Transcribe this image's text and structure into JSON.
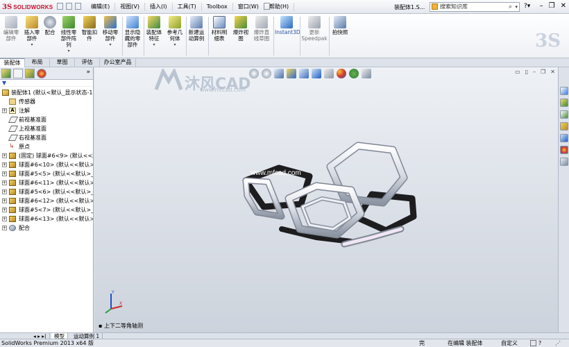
{
  "app": {
    "brand": "SOLIDWORKS",
    "menus": [
      "编辑(E)",
      "视图(V)",
      "插入(I)",
      "工具(T)",
      "Toolbox",
      "窗口(W)",
      "帮助(H)"
    ],
    "doc_title": "装配体1.S...",
    "search_placeholder": "搜索知识库"
  },
  "ribbon": {
    "buttons": [
      {
        "label": "编辑零\n部件",
        "icon": "edit-component-icon"
      },
      {
        "label": "插入零\n部件",
        "icon": "insert-component-icon"
      },
      {
        "label": "配合",
        "icon": "mate-icon"
      },
      {
        "label": "线性零\n部件阵\n列",
        "icon": "linear-pattern-icon"
      },
      {
        "label": "智能扣\n件",
        "icon": "smart-fastener-icon"
      },
      {
        "label": "移动零\n部件",
        "icon": "move-component-icon"
      },
      {
        "label": "显示隐\n藏的零\n部件",
        "icon": "show-hidden-icon"
      },
      {
        "label": "装配体\n特征",
        "icon": "assembly-feature-icon"
      },
      {
        "label": "参考几\n何体",
        "icon": "reference-geometry-icon"
      },
      {
        "label": "新建运\n动算例",
        "icon": "motion-study-icon"
      },
      {
        "label": "材料明\n细表",
        "icon": "bom-icon"
      },
      {
        "label": "爆炸视\n图",
        "icon": "exploded-view-icon"
      },
      {
        "label": "爆炸直\n线草图",
        "icon": "explode-line-icon"
      },
      {
        "label": "Instant3D",
        "icon": "instant3d-icon"
      },
      {
        "label": "更新\nSpeedpak",
        "icon": "speedpak-icon"
      },
      {
        "label": "拍快照",
        "icon": "snapshot-icon"
      }
    ]
  },
  "tabs": [
    "装配体",
    "布局",
    "草图",
    "评估",
    "办公室产品"
  ],
  "tree": {
    "root": "装配体1 (默认<默认_显示状态-1>)",
    "items": [
      {
        "label": "传感器",
        "icon": "sensor-icon",
        "expand": false
      },
      {
        "label": "注解",
        "icon": "annotation-icon",
        "expand": true
      },
      {
        "label": "前视基准面",
        "icon": "plane-icon",
        "expand": false
      },
      {
        "label": "上视基准面",
        "icon": "plane-icon",
        "expand": false
      },
      {
        "label": "右视基准面",
        "icon": "plane-icon",
        "expand": false
      },
      {
        "label": "原点",
        "icon": "origin-icon",
        "expand": false
      },
      {
        "label": "(固定) 球面#6<9> (默认<<默认>",
        "icon": "part-icon",
        "expand": true
      },
      {
        "label": "球面#6<10> (默认<<默认>_显",
        "icon": "part-icon",
        "expand": true
      },
      {
        "label": "球面#5<5> (默认<<默认>_显",
        "icon": "part-icon",
        "expand": true
      },
      {
        "label": "球面#6<11> (默认<<默认>_显",
        "icon": "part-icon",
        "expand": true
      },
      {
        "label": "球面#5<6> (默认<<默认>_显",
        "icon": "part-icon",
        "expand": true
      },
      {
        "label": "球面#6<12> (默认<<默认>_显",
        "icon": "part-icon",
        "expand": true
      },
      {
        "label": "球面#5<7> (默认<<默认>_显",
        "icon": "part-icon",
        "expand": true
      },
      {
        "label": "球面#6<13> (默认<<默认>_显",
        "icon": "part-icon",
        "expand": true
      },
      {
        "label": "配合",
        "icon": "mate-icon",
        "expand": true
      }
    ]
  },
  "bottom_tabs": [
    "模型",
    "运动算例 1"
  ],
  "viewport": {
    "watermark_text": "沐风CAD",
    "watermark_url": "www.mfcad.com",
    "overlay_url": "www.mfcad.com",
    "view_name": "上下二等角轴测"
  },
  "status": {
    "left": "SolidWorks Premium 2013 x64 版",
    "s2": "完",
    "s3": "在编辑 装配体",
    "s4": "自定义",
    "s6": "?"
  }
}
